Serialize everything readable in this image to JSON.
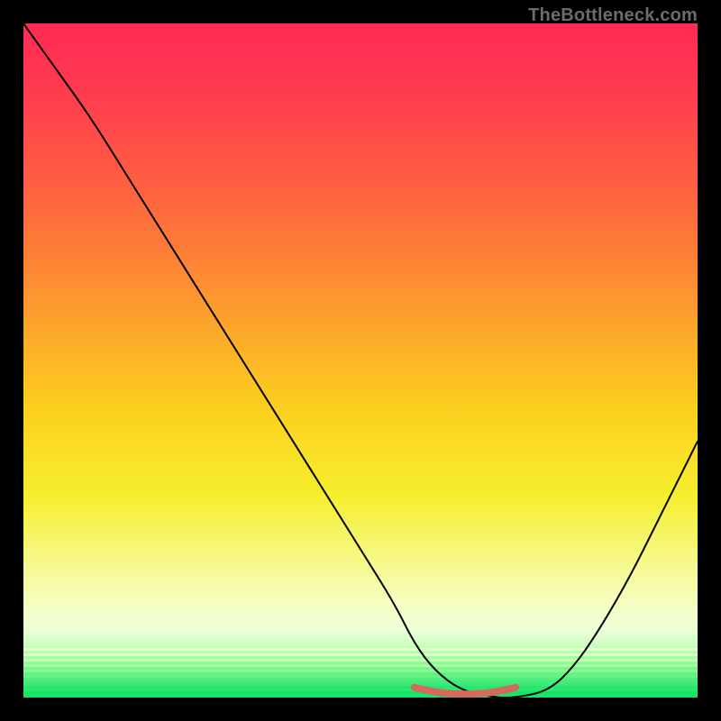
{
  "watermark": {
    "text": "TheBottleneck.com"
  },
  "chart_data": {
    "type": "line",
    "title": "",
    "xlabel": "",
    "ylabel": "",
    "xlim": [
      0,
      100
    ],
    "ylim": [
      0,
      100
    ],
    "grid": false,
    "legend": false,
    "background": {
      "gradient": "vertical",
      "stops": [
        {
          "pct": 0,
          "color": "#ff2956"
        },
        {
          "pct": 10,
          "color": "#ff3b4f"
        },
        {
          "pct": 22,
          "color": "#ff5a44"
        },
        {
          "pct": 34,
          "color": "#fe7e36"
        },
        {
          "pct": 46,
          "color": "#fca92a"
        },
        {
          "pct": 58,
          "color": "#fbd21e"
        },
        {
          "pct": 70,
          "color": "#f6ee2d"
        },
        {
          "pct": 80,
          "color": "#f6f98b"
        },
        {
          "pct": 86,
          "color": "#f5fec0"
        },
        {
          "pct": 90,
          "color": "#edffd9"
        },
        {
          "pct": 92,
          "color": "#d0fec2"
        },
        {
          "pct": 94,
          "color": "#a5fca6"
        },
        {
          "pct": 96,
          "color": "#6ff48a"
        },
        {
          "pct": 98,
          "color": "#3ceb77"
        },
        {
          "pct": 100,
          "color": "#13e367"
        }
      ]
    },
    "series": [
      {
        "name": "bottleneck-curve",
        "color": "#000000",
        "width": 2,
        "x": [
          0,
          5,
          10,
          15,
          20,
          25,
          30,
          35,
          40,
          45,
          50,
          55,
          58,
          61,
          65,
          70,
          73,
          78,
          82,
          86,
          90,
          94,
          98,
          100
        ],
        "y": [
          100,
          93,
          86,
          78,
          70,
          62,
          54,
          46,
          38,
          30,
          22,
          14,
          8,
          4,
          1,
          0,
          0,
          1,
          5,
          11,
          18,
          26,
          34,
          38
        ]
      },
      {
        "name": "flat-zone-marker",
        "color": "#d4695e",
        "width": 8,
        "x": [
          58,
          61,
          64,
          67,
          70,
          73
        ],
        "y": [
          1.5,
          0.8,
          0.5,
          0.5,
          0.8,
          1.5
        ]
      }
    ],
    "annotations": []
  }
}
